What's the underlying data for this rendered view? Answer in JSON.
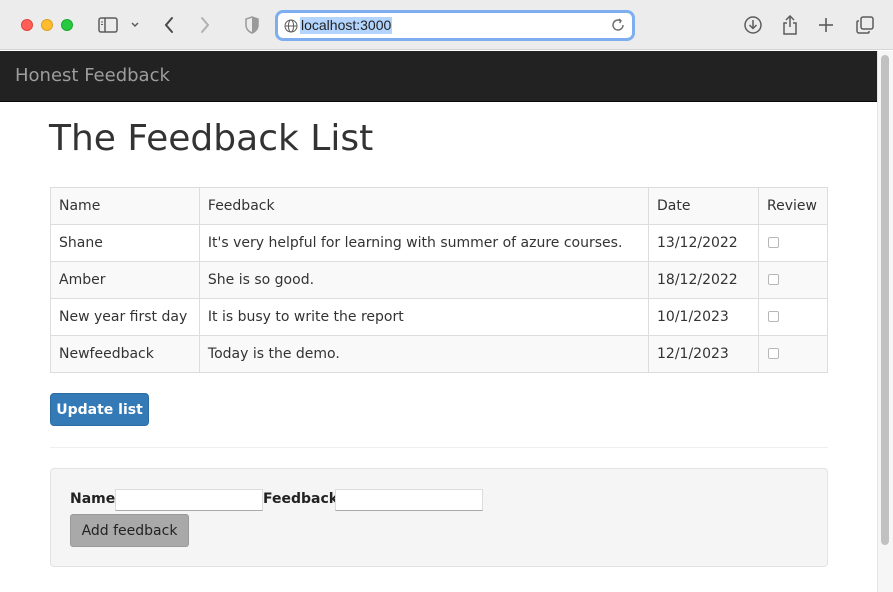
{
  "browser": {
    "url": "localhost:3000",
    "icons": [
      "sidebar-icon",
      "chevron-down-icon",
      "back-icon",
      "forward-icon",
      "shield-icon",
      "globe-icon",
      "reload-icon",
      "download-icon",
      "share-icon",
      "new-tab-icon",
      "tabs-overview-icon"
    ]
  },
  "navbar": {
    "brand": "Honest Feedback"
  },
  "main": {
    "title": "The Feedback List",
    "table": {
      "headers": {
        "name": "Name",
        "feedback": "Feedback",
        "date": "Date",
        "review": "Review"
      },
      "rows": [
        {
          "name": "Shane",
          "feedback": "It's very helpful for learning with summer of azure courses.",
          "date": "13/12/2022",
          "review": false
        },
        {
          "name": "Amber",
          "feedback": "She is so good.",
          "date": "18/12/2022",
          "review": false
        },
        {
          "name": "New year first day",
          "feedback": "It is busy to write the report",
          "date": "10/1/2023",
          "review": false
        },
        {
          "name": "Newfeedback",
          "feedback": "Today is the demo.",
          "date": "12/1/2023",
          "review": false
        }
      ]
    },
    "update_button": "Update list"
  },
  "form": {
    "name_label": "Name:",
    "name_value": "",
    "feedback_label": "Feedback:",
    "feedback_value": "",
    "add_button": "Add feedback"
  },
  "colors": {
    "navbar_bg": "#222222",
    "primary": "#337ab7",
    "url_focus": "#7eaef0"
  }
}
